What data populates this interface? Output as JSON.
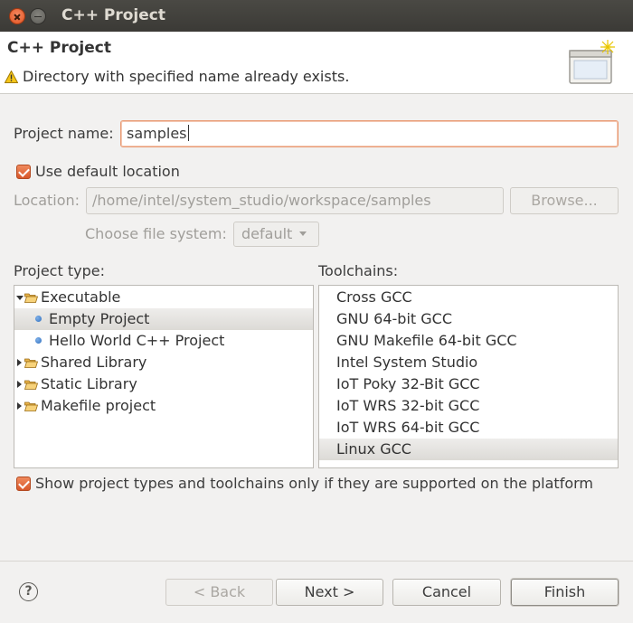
{
  "window": {
    "title": "C++ Project"
  },
  "banner": {
    "title": "C++ Project",
    "message": "Directory with specified name already exists."
  },
  "form": {
    "project_name_label": "Project name:",
    "project_name_value": "samples",
    "use_default_location_label": "Use default location",
    "use_default_location_checked": true,
    "location_label": "Location:",
    "location_value": "/home/intel/system_studio/workspace/samples",
    "browse_label": "Browse...",
    "file_system_label": "Choose file system:",
    "file_system_value": "default"
  },
  "project_type": {
    "label": "Project type:",
    "items": [
      {
        "label": "Executable",
        "kind": "folder",
        "expanded": true
      },
      {
        "label": "Empty Project",
        "kind": "leaf",
        "selected": true
      },
      {
        "label": "Hello World C++ Project",
        "kind": "leaf"
      },
      {
        "label": "Shared Library",
        "kind": "folder",
        "expanded": false
      },
      {
        "label": "Static Library",
        "kind": "folder",
        "expanded": false
      },
      {
        "label": "Makefile project",
        "kind": "folder",
        "expanded": false
      }
    ]
  },
  "toolchains": {
    "label": "Toolchains:",
    "items": [
      {
        "label": "Cross GCC"
      },
      {
        "label": "GNU 64-bit GCC"
      },
      {
        "label": "GNU Makefile 64-bit GCC"
      },
      {
        "label": "Intel System Studio"
      },
      {
        "label": "IoT Poky 32-Bit GCC"
      },
      {
        "label": "IoT WRS 32-bit GCC"
      },
      {
        "label": "IoT WRS 64-bit GCC"
      },
      {
        "label": "Linux GCC",
        "selected": true
      }
    ]
  },
  "filter": {
    "label": "Show project types and toolchains only if they are supported on the platform",
    "checked": true
  },
  "footer": {
    "help_label": "?",
    "back_label": "< Back",
    "next_label": "Next >",
    "cancel_label": "Cancel",
    "finish_label": "Finish"
  },
  "colors": {
    "accent": "#e2521f",
    "titlebar": "#3c3b37"
  }
}
